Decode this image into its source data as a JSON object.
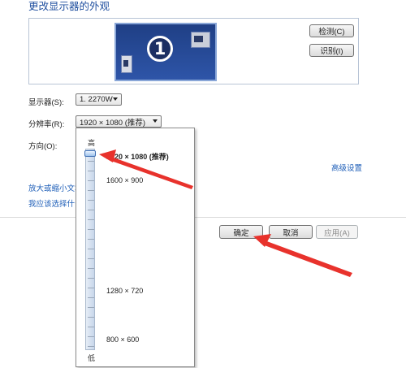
{
  "page": {
    "title": "更改显示器的外观"
  },
  "preview": {
    "monitor_number": "1"
  },
  "buttons": {
    "detect": "检测(C)",
    "identify": "识别(I)",
    "ok": "确定",
    "cancel": "取消",
    "apply": "应用(A)"
  },
  "fields": {
    "display": {
      "label": "显示器(S):",
      "value": "1. 2270W"
    },
    "resolution": {
      "label": "分辨率(R):",
      "value": "1920 × 1080 (推荐)"
    },
    "orientation": {
      "label": "方向(O):"
    }
  },
  "links": {
    "advanced": "高级设置",
    "text_size": "放大或缩小文本",
    "choose": "我应该选择什么"
  },
  "resolution_popup": {
    "high_label": "高",
    "low_label": "低",
    "options": [
      "1920 × 1080 (推荐)",
      "1600 × 900",
      "1280 × 720",
      "800 × 600"
    ],
    "selected_index": 0,
    "slider_level": 1.0
  },
  "annotations": {
    "arrow_color": "#e8322c"
  }
}
